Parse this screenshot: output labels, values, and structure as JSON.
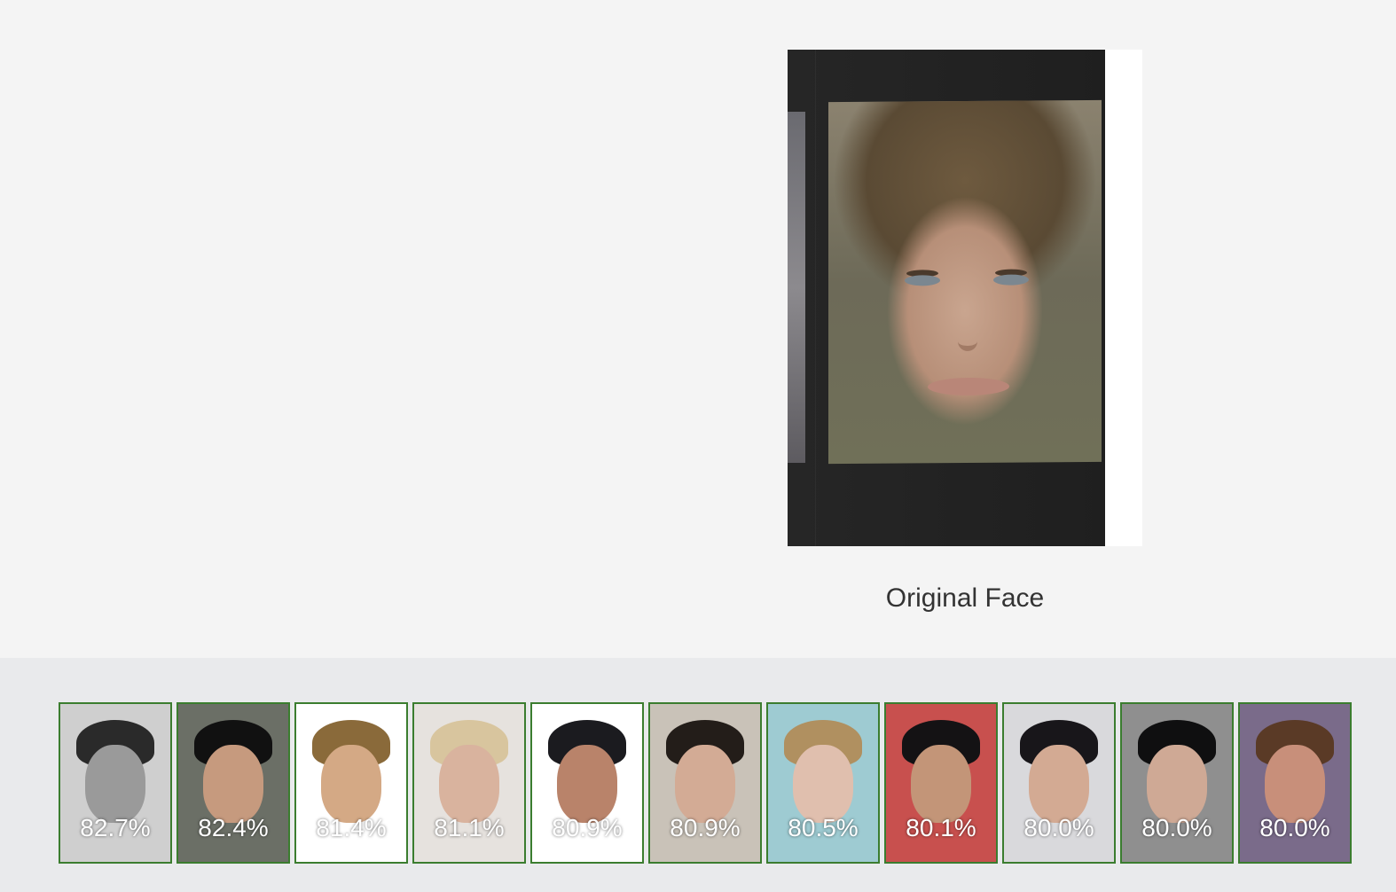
{
  "original": {
    "caption": "Original Face",
    "image_icon": "face-photo"
  },
  "colors": {
    "match_border": "#3b7d2f",
    "top_background": "#f4f4f4",
    "bottom_background": "#e9eaec"
  },
  "matches": [
    {
      "score": "82.7%",
      "bg": "#cfcfcf",
      "skin": "#9a9a9a",
      "hair": "#2a2a2a"
    },
    {
      "score": "82.4%",
      "bg": "#6b6f66",
      "skin": "#c69a7e",
      "hair": "#111111"
    },
    {
      "score": "81.4%",
      "bg": "#ffffff",
      "skin": "#d4a985",
      "hair": "#8a6a3a"
    },
    {
      "score": "81.1%",
      "bg": "#e6e2de",
      "skin": "#d9b39e",
      "hair": "#d8c59e"
    },
    {
      "score": "80.9%",
      "bg": "#ffffff",
      "skin": "#b9836a",
      "hair": "#1b1b1f"
    },
    {
      "score": "80.9%",
      "bg": "#c9c2b8",
      "skin": "#d3ab95",
      "hair": "#231d19"
    },
    {
      "score": "80.5%",
      "bg": "#9ecbd2",
      "skin": "#e0bfae",
      "hair": "#b09060"
    },
    {
      "score": "80.1%",
      "bg": "#c8504e",
      "skin": "#c39578",
      "hair": "#141214"
    },
    {
      "score": "80.0%",
      "bg": "#d9d9dc",
      "skin": "#d3aa93",
      "hair": "#18161a"
    },
    {
      "score": "80.0%",
      "bg": "#8f8f8f",
      "skin": "#cfa995",
      "hair": "#0f0f10"
    },
    {
      "score": "80.0%",
      "bg": "#7a6b8a",
      "skin": "#c88f7a",
      "hair": "#5a3a26"
    }
  ]
}
